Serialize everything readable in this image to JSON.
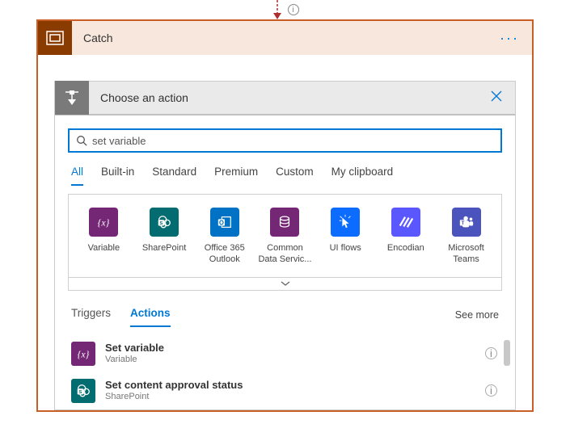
{
  "step": {
    "title": "Catch"
  },
  "picker": {
    "title": "Choose an action",
    "search_value": "set variable",
    "category_tabs": [
      "All",
      "Built-in",
      "Standard",
      "Premium",
      "Custom",
      "My clipboard"
    ],
    "active_category": "All",
    "connectors": [
      {
        "label": "Variable",
        "cls": "c-variable",
        "icon": "variable"
      },
      {
        "label": "SharePoint",
        "cls": "c-sharepoint",
        "icon": "sharepoint"
      },
      {
        "label": "Office 365 Outlook",
        "cls": "c-outlook",
        "icon": "outlook"
      },
      {
        "label": "Common Data Servic...",
        "cls": "c-cds",
        "icon": "database"
      },
      {
        "label": "UI flows",
        "cls": "c-uiflows",
        "icon": "cursor"
      },
      {
        "label": "Encodian",
        "cls": "c-encodian",
        "icon": "stripes"
      },
      {
        "label": "Microsoft Teams",
        "cls": "c-teams",
        "icon": "teams"
      }
    ],
    "sub_tabs": [
      "Triggers",
      "Actions"
    ],
    "active_sub_tab": "Actions",
    "see_more": "See more",
    "results": [
      {
        "title": "Set variable",
        "sub": "Variable",
        "cls": "c-variable",
        "icon": "variable"
      },
      {
        "title": "Set content approval status",
        "sub": "SharePoint",
        "cls": "c-sharepoint",
        "icon": "sharepoint"
      }
    ]
  },
  "glyphs": {
    "info": "i",
    "ellipsis": "···"
  }
}
